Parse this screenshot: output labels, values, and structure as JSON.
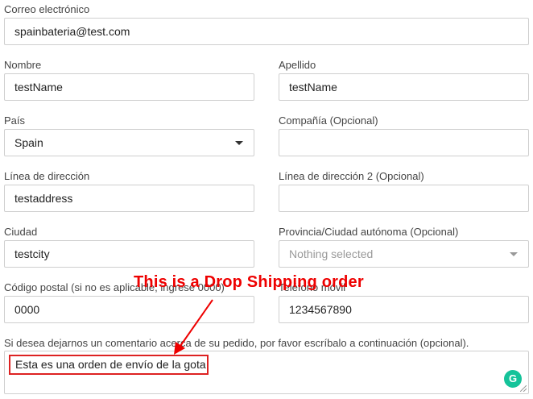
{
  "email": {
    "label": "Correo electrónico",
    "value": "spainbateria@test.com"
  },
  "first_name": {
    "label": "Nombre",
    "value": "testName"
  },
  "last_name": {
    "label": "Apellido",
    "value": "testName"
  },
  "country": {
    "label": "País",
    "value": "Spain"
  },
  "company": {
    "label": "Compañía (Opcional)",
    "value": ""
  },
  "address1": {
    "label": "Línea de dirección",
    "value": "testaddress"
  },
  "address2": {
    "label": "Línea de dirección 2 (Opcional)",
    "value": ""
  },
  "city": {
    "label": "Ciudad",
    "value": "testcity"
  },
  "province": {
    "label": "Provincia/Ciudad autónoma (Opcional)",
    "value": "Nothing selected"
  },
  "postal": {
    "label": "Código postal (si no es aplicable, ingrese 0000)",
    "value": "0000"
  },
  "phone": {
    "label": "Teléfono móvil",
    "value": "1234567890"
  },
  "comment": {
    "label": "Si desea dejarnos un comentario acerca de su pedido, por favor escríbalo a continuación (opcional).",
    "value": "Esta es una orden de envío de la gota"
  },
  "annotation": {
    "text": "This is a Drop Shipping order",
    "color": "#e00000"
  },
  "grammarly_icon": {
    "glyph": "G",
    "color": "#15c39a"
  }
}
